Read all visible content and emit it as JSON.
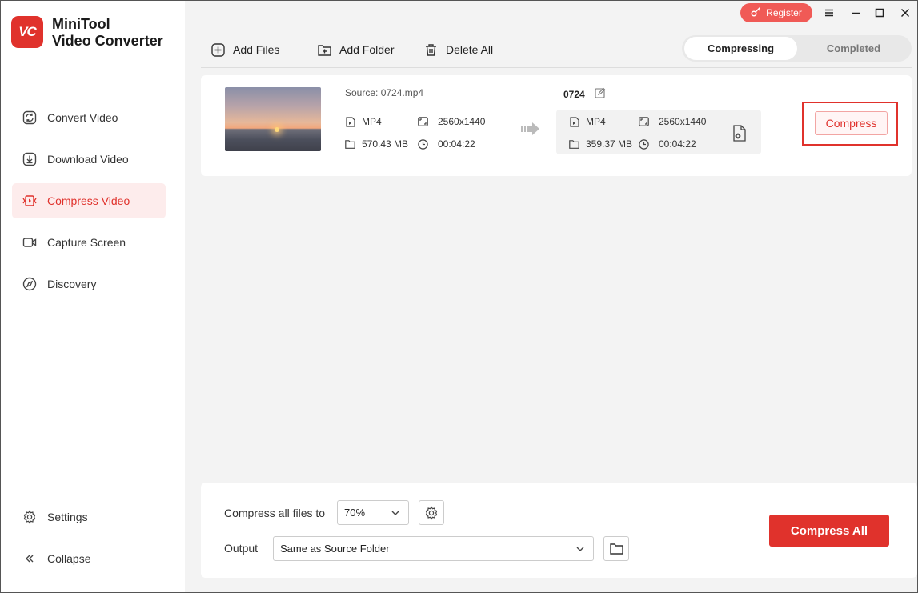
{
  "app": {
    "logo_text": "VC",
    "title_line1": "MiniTool",
    "title_line2": "Video Converter"
  },
  "titlebar": {
    "register_label": "Register"
  },
  "sidebar": {
    "items": [
      {
        "label": "Convert Video",
        "icon": "convert-icon"
      },
      {
        "label": "Download Video",
        "icon": "download-icon"
      },
      {
        "label": "Compress Video",
        "icon": "compress-icon",
        "active": true
      },
      {
        "label": "Capture Screen",
        "icon": "camera-icon"
      },
      {
        "label": "Discovery",
        "icon": "compass-icon"
      }
    ],
    "settings_label": "Settings",
    "collapse_label": "Collapse"
  },
  "toolbar": {
    "add_files": "Add Files",
    "add_folder": "Add Folder",
    "delete_all": "Delete All",
    "tab_compressing": "Compressing",
    "tab_completed": "Completed"
  },
  "file": {
    "source_label": "Source:",
    "source_name": "0724.mp4",
    "source_format": "MP4",
    "source_resolution": "2560x1440",
    "source_size": "570.43 MB",
    "source_duration": "00:04:22",
    "output_name": "0724",
    "output_format": "MP4",
    "output_resolution": "2560x1440",
    "output_size": "359.37 MB",
    "output_duration": "00:04:22",
    "compress_label": "Compress"
  },
  "bottom": {
    "compress_all_files_label": "Compress all files to",
    "ratio_value": "70%",
    "output_label": "Output",
    "output_value": "Same as Source Folder",
    "compress_all_label": "Compress All"
  },
  "colors": {
    "accent": "#e0322c",
    "register": "#f05a56",
    "active_nav_bg": "#fdecec"
  }
}
